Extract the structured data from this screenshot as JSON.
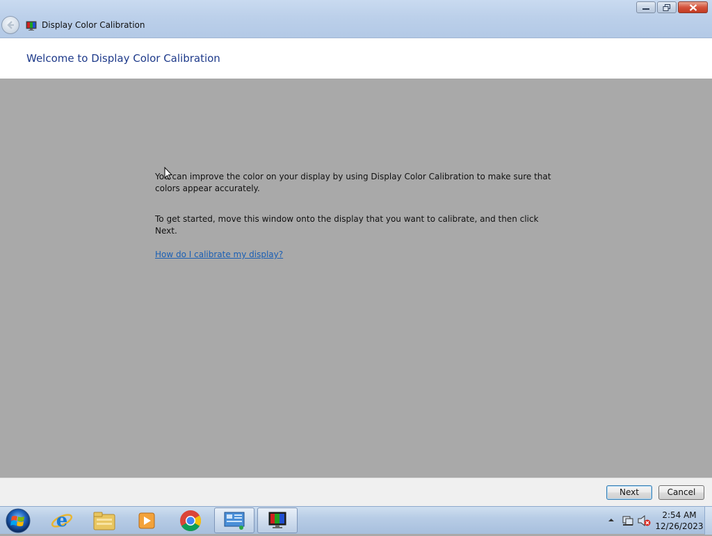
{
  "window": {
    "title": "Display Color Calibration",
    "page_title": "Welcome to Display Color Calibration"
  },
  "content": {
    "paragraph1": "You can improve the color on your display by using Display Color Calibration to make sure that colors appear accurately.",
    "paragraph2": "To get started, move this window onto the display that you want to calibrate, and then click Next.",
    "help_link": "How do I calibrate my display?"
  },
  "footer": {
    "next_label": "Next",
    "cancel_label": "Cancel"
  },
  "taskbar": {
    "items": [
      "start-orb",
      "internet-explorer-icon",
      "file-explorer-icon",
      "media-player-icon",
      "chrome-icon",
      "control-panel-icon",
      "display-calibration-icon"
    ],
    "clock_time": "2:54 AM",
    "clock_date": "12/26/2023"
  },
  "colors": {
    "title_blue": "#1e3a8a",
    "link_blue": "#1a5fb4",
    "content_bg": "#a9a9a9"
  }
}
